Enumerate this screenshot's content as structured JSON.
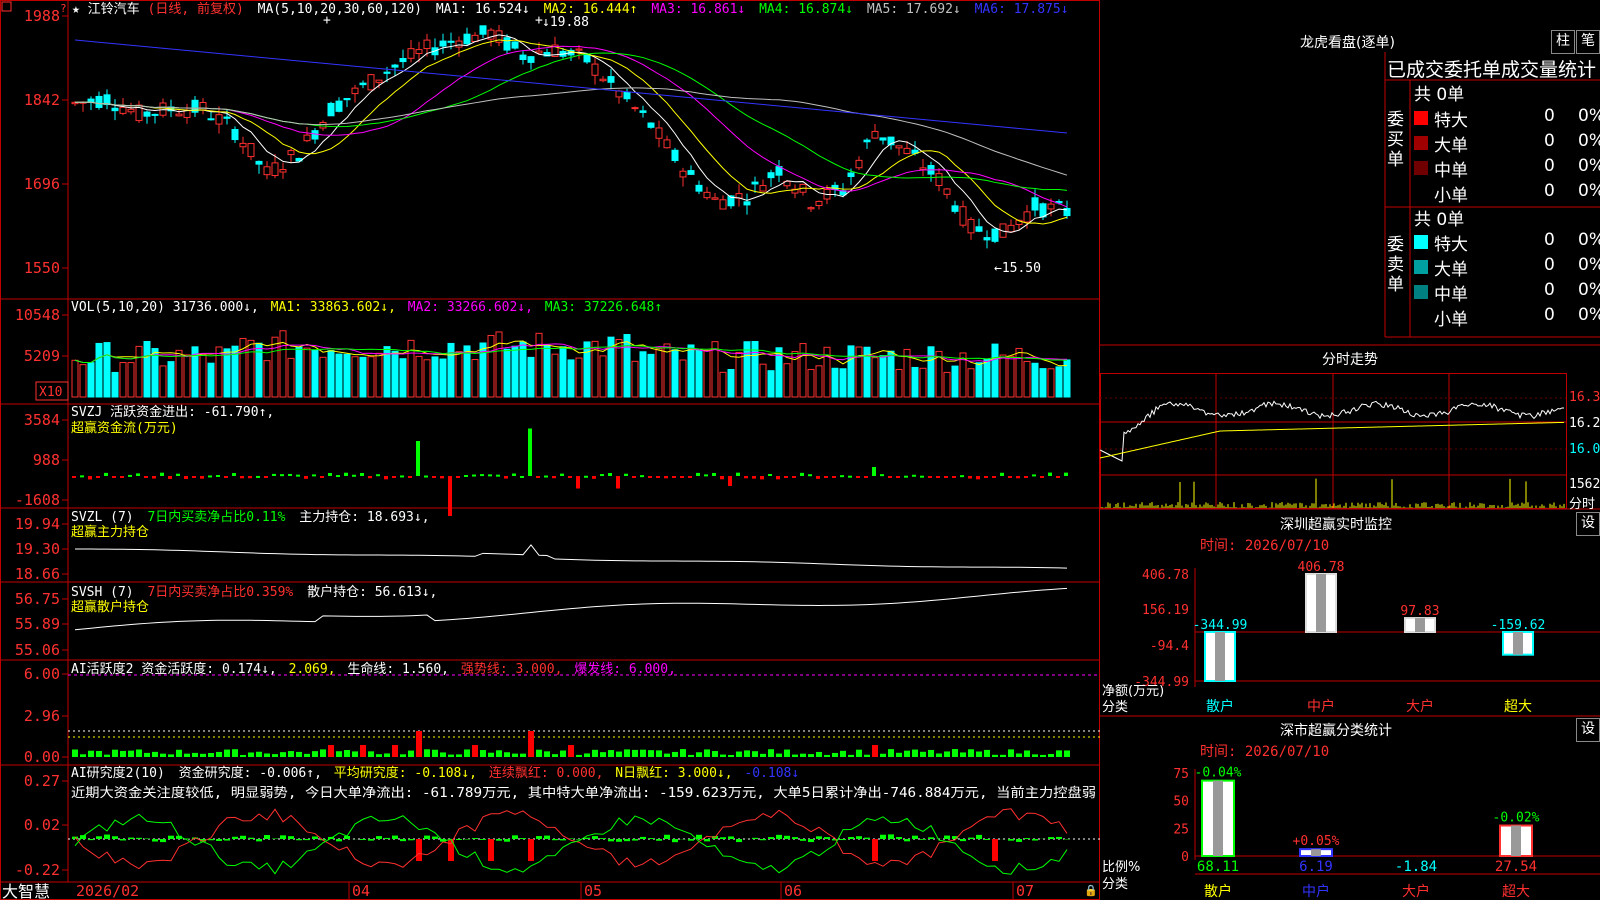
{
  "main_header": {
    "star": "★",
    "stock_name": "江铃汽车",
    "period": "(日线, 前复权)",
    "ma_params": "MA(5,10,20,30,60,120)",
    "ma": [
      {
        "label": "MA1: 16.524↓",
        "color": "#ffffff"
      },
      {
        "label": "MA2: 16.444↑",
        "color": "#ffff00"
      },
      {
        "label": "MA3: 16.861↓",
        "color": "#ff00ff"
      },
      {
        "label": "MA4: 16.874↓",
        "color": "#00ff00"
      },
      {
        "label": "MA5: 17.692↓",
        "color": "#c0c0c0"
      },
      {
        "label": "MA6: 17.875↓",
        "color": "#3333ff"
      }
    ],
    "price_axis": [
      "1988",
      "1842",
      "1696",
      "1550"
    ],
    "high_label": "↓19.88",
    "low_label": "←15.50"
  },
  "vol_panel": {
    "title": "VOL(5,10,20) 31736.000↓,",
    "ma1": "MA1: 33863.602↓,",
    "ma2": "MA2: 33266.602↓,",
    "ma3": "MA3: 37226.648↑",
    "axis": [
      "10548",
      "5209"
    ],
    "unit": "X10"
  },
  "svzj_panel": {
    "title": "SVZJ 活跃资金进出: -61.790↑,",
    "subtitle": "超赢资金流(万元)",
    "axis": [
      "3584",
      "988",
      "-1608"
    ]
  },
  "svzl_panel": {
    "title": "SVZL (7)",
    "stat": "7日内买卖净占比0.11%",
    "hold": "主力持仓: 18.693↓,",
    "subtitle": "超赢主力持仓",
    "axis": [
      "19.94",
      "19.30",
      "18.66"
    ]
  },
  "svsh_panel": {
    "title": "SVSH (7)",
    "stat": "7日内买卖净占比0.359%",
    "hold": "散户持仓: 56.613↓,",
    "subtitle": "超赢散户持仓",
    "axis": [
      "56.75",
      "55.89",
      "55.06"
    ]
  },
  "ai_active_panel": {
    "title": "AI活跃度2 资金活跃度: 0.174↓,",
    "v2": "2.069,",
    "life": "生命线: 1.560,",
    "strong": "强势线: 3.000,",
    "burst": "爆发线: 6.000,",
    "axis": [
      "6.00",
      "2.96",
      "0.00"
    ]
  },
  "ai_research_panel": {
    "title": "AI研究度2(10)",
    "research": "资金研究度: -0.006↑,",
    "avg": "平均研究度: -0.108↓,",
    "red": "连续飘红: 0.000,",
    "nred": "N日飘红: 3.000↓,",
    "last": "-0.108↓",
    "comment": "近期大资金关注度较低, 明显弱势, 今日大单净流出: -61.789万元, 其中特大单净流出: -159.623万元, 大单5日累计净出-746.884万元, 当前主力控盘弱",
    "axis": [
      "0.27",
      "0.02",
      "-0.22"
    ]
  },
  "date_axis": {
    "brand": "大智慧",
    "labels": [
      "2026/02",
      "04",
      "05",
      "06",
      "07"
    ]
  },
  "right_panel": {
    "lhb_title": "龙虎看盘(逐单)",
    "btn_zhu": "柱",
    "btn_bi": "笔",
    "stats_title": "已成交委托单成交量统计",
    "buy_label": "委买单",
    "sell_label": "委卖单",
    "buy_total": "共 0单",
    "sell_total": "共 0单",
    "buy_rows": [
      {
        "name": "特大",
        "count": "0",
        "pct": "0%",
        "color": "#ff0000"
      },
      {
        "name": "大单",
        "count": "0",
        "pct": "0%",
        "color": "#a00000"
      },
      {
        "name": "中单",
        "count": "0",
        "pct": "0%",
        "color": "#700000"
      },
      {
        "name": "小单",
        "count": "0",
        "pct": "0%",
        "color": "#000000"
      }
    ],
    "sell_rows": [
      {
        "name": "特大",
        "count": "0",
        "pct": "0%",
        "color": "#00ffff"
      },
      {
        "name": "大单",
        "count": "0",
        "pct": "0%",
        "color": "#00a0a0"
      },
      {
        "name": "中单",
        "count": "0",
        "pct": "0%",
        "color": "#008080"
      },
      {
        "name": "小单",
        "count": "0",
        "pct": "0%",
        "color": "#000000"
      }
    ],
    "intraday_title": "分时走势",
    "intraday_axis": [
      "16.35",
      "16.22",
      "16.08"
    ],
    "intraday_vol": "1562",
    "intraday_unit": "分时",
    "sz_title": "深圳超赢实时监控",
    "sz_btn": "设",
    "sz_time": "时间: 2026/07/10",
    "sz_axis": [
      "406.78",
      "156.19",
      "-94.4",
      "-344.99"
    ],
    "sz_yname": "净额(万元)",
    "sz_xname": "分类",
    "sz_categories": [
      "散户",
      "中户",
      "大户",
      "超大"
    ],
    "sz_values": [
      "-344.99",
      "406.78",
      "97.83",
      "-159.62"
    ],
    "sc_title": "深市超赢分类统计",
    "sc_btn": "设",
    "sc_time": "时间: 2026/07/10",
    "sc_axis": [
      "75",
      "50",
      "25",
      "0"
    ],
    "sc_yname": "比例%",
    "sc_xname": "分类",
    "sc_categories": [
      "散户",
      "中户",
      "大户",
      "超大"
    ],
    "sc_top": [
      "-0.04%",
      "+0.05%",
      "",
      "-0.02%"
    ],
    "sc_bottom": [
      "68.11",
      "6.19",
      "-1.84",
      "27.54"
    ]
  },
  "chart_data": [
    {
      "type": "bar",
      "title": "深圳超赢实时监控",
      "ylabel": "净额(万元)",
      "xlabel": "分类",
      "categories": [
        "散户",
        "中户",
        "大户",
        "超大"
      ],
      "values": [
        -344.99,
        406.78,
        97.83,
        -159.62
      ],
      "ylim": [
        -344.99,
        406.78
      ]
    },
    {
      "type": "bar",
      "title": "深市超赢分类统计",
      "ylabel": "比例%",
      "xlabel": "分类",
      "categories": [
        "散户",
        "中户",
        "大户",
        "超大"
      ],
      "values": [
        68.11,
        6.19,
        -1.84,
        27.54
      ],
      "ylim": [
        0,
        75
      ]
    }
  ]
}
